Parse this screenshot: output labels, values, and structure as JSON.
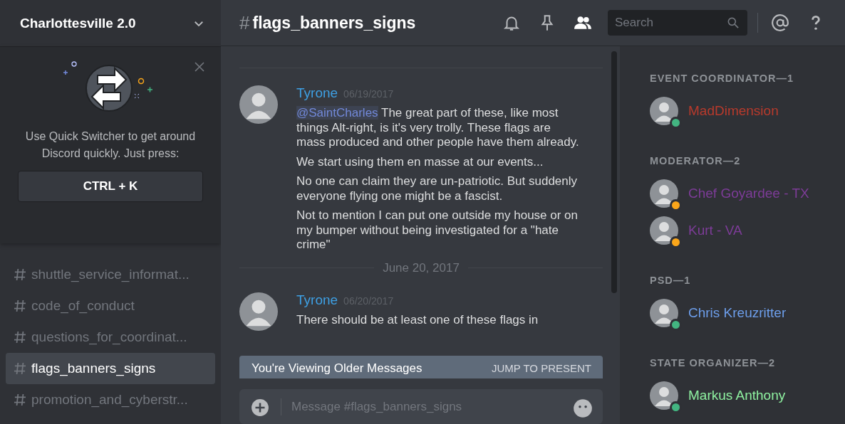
{
  "server": {
    "name": "Charlottesville 2.0"
  },
  "quick_switcher": {
    "text": "Use Quick Switcher to get around Discord quickly. Just press:",
    "shortcut": "CTRL + K"
  },
  "channels": [
    {
      "name": "shuttle_service_informat...",
      "selected": false
    },
    {
      "name": "code_of_conduct",
      "selected": false
    },
    {
      "name": "questions_for_coordinat...",
      "selected": false
    },
    {
      "name": "flags_banners_signs",
      "selected": true
    },
    {
      "name": "promotion_and_cyberstr...",
      "selected": false
    }
  ],
  "channel_header": {
    "hash": "#",
    "name": "flags_banners_signs",
    "search_placeholder": "Search"
  },
  "messages": [
    {
      "kind": "message",
      "author": "Tyrone",
      "timestamp": "06/19/2017",
      "paragraphs": [
        {
          "mention": "@SaintCharles",
          "text": "The great part of these, like most things Alt-right, is it's very trolly. These flags are mass produced and other people have them already."
        },
        {
          "text": "We start using them en masse at our events..."
        },
        {
          "text": "No one can claim they are un-patriotic. But suddenly everyone flying one might be a fascist."
        },
        {
          "text": "Not to mention I can put one outside my house or on my bumper without being investigated for a \"hate crime\""
        }
      ]
    },
    {
      "kind": "divider",
      "label": "June 20, 2017"
    },
    {
      "kind": "message",
      "author": "Tyrone",
      "timestamp": "06/20/2017",
      "paragraphs": [
        {
          "text": "There should be at least one of these flags in"
        }
      ]
    }
  ],
  "older_banner": {
    "text": "You're Viewing Older Messages",
    "action": "JUMP TO PRESENT"
  },
  "composer": {
    "placeholder": "Message #flags_banners_signs"
  },
  "member_groups": [
    {
      "title": "EVENT COORDINATOR—1",
      "members": [
        {
          "name": "MadDimension",
          "color": "#b83a2c",
          "kind": "online"
        }
      ]
    },
    {
      "title": "MODERATOR—2",
      "members": [
        {
          "name": "Chef Goyardee - TX",
          "color": "#7d3c98",
          "kind": "idle"
        },
        {
          "name": "Kurt - VA",
          "color": "#7d3c98",
          "kind": "idle"
        }
      ]
    },
    {
      "title": "PSD—1",
      "members": [
        {
          "name": "Chris Kreuzritter",
          "color": "#6d9eeb",
          "kind": "online"
        }
      ]
    },
    {
      "title": "STATE ORGANIZER—2",
      "members": [
        {
          "name": "Markus Anthony",
          "color": "#8ef0a0",
          "kind": "online"
        }
      ]
    }
  ]
}
